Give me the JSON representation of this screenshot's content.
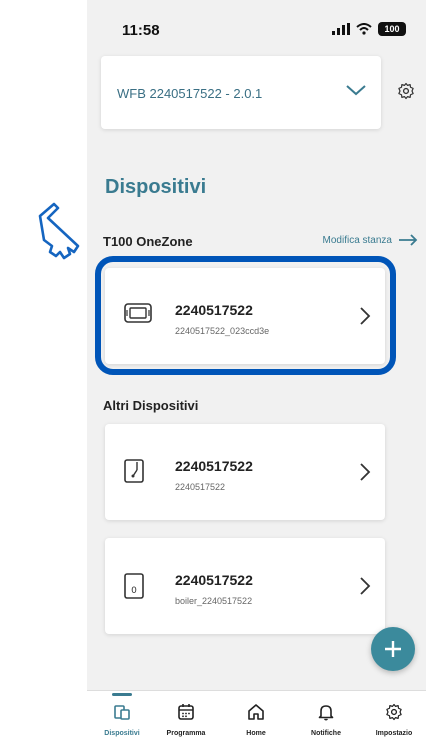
{
  "status_bar": {
    "time": "11:58",
    "battery": "100"
  },
  "header": {
    "device_selector_label": "WFB 2240517522 - 2.0.1"
  },
  "section": {
    "title": "Dispositivi"
  },
  "zone": {
    "name": "T100 OneZone",
    "edit_label": "Modifica stanza"
  },
  "zone_devices": [
    {
      "title": "2240517522",
      "subtitle": "2240517522_023ccd3e",
      "icon": "thermostat-icon"
    }
  ],
  "others": {
    "title": "Altri Dispositivi",
    "devices": [
      {
        "title": "2240517522",
        "subtitle": "2240517522",
        "icon": "device-module-icon"
      },
      {
        "title": "2240517522",
        "subtitle": "boiler_2240517522",
        "icon": "boiler-icon"
      }
    ]
  },
  "tabs": [
    {
      "label": "Dispositivi",
      "icon": "devices-icon",
      "active": true
    },
    {
      "label": "Programma",
      "icon": "calendar-icon",
      "active": false
    },
    {
      "label": "Home",
      "icon": "home-icon",
      "active": false
    },
    {
      "label": "Notifiche",
      "icon": "bell-icon",
      "active": false
    },
    {
      "label": "Impostazio",
      "icon": "gear-icon",
      "active": false
    }
  ],
  "colors": {
    "accent": "#3a7b90",
    "highlight": "#0055b8",
    "fab": "#3b8a9c",
    "background": "#f1f1f1"
  }
}
